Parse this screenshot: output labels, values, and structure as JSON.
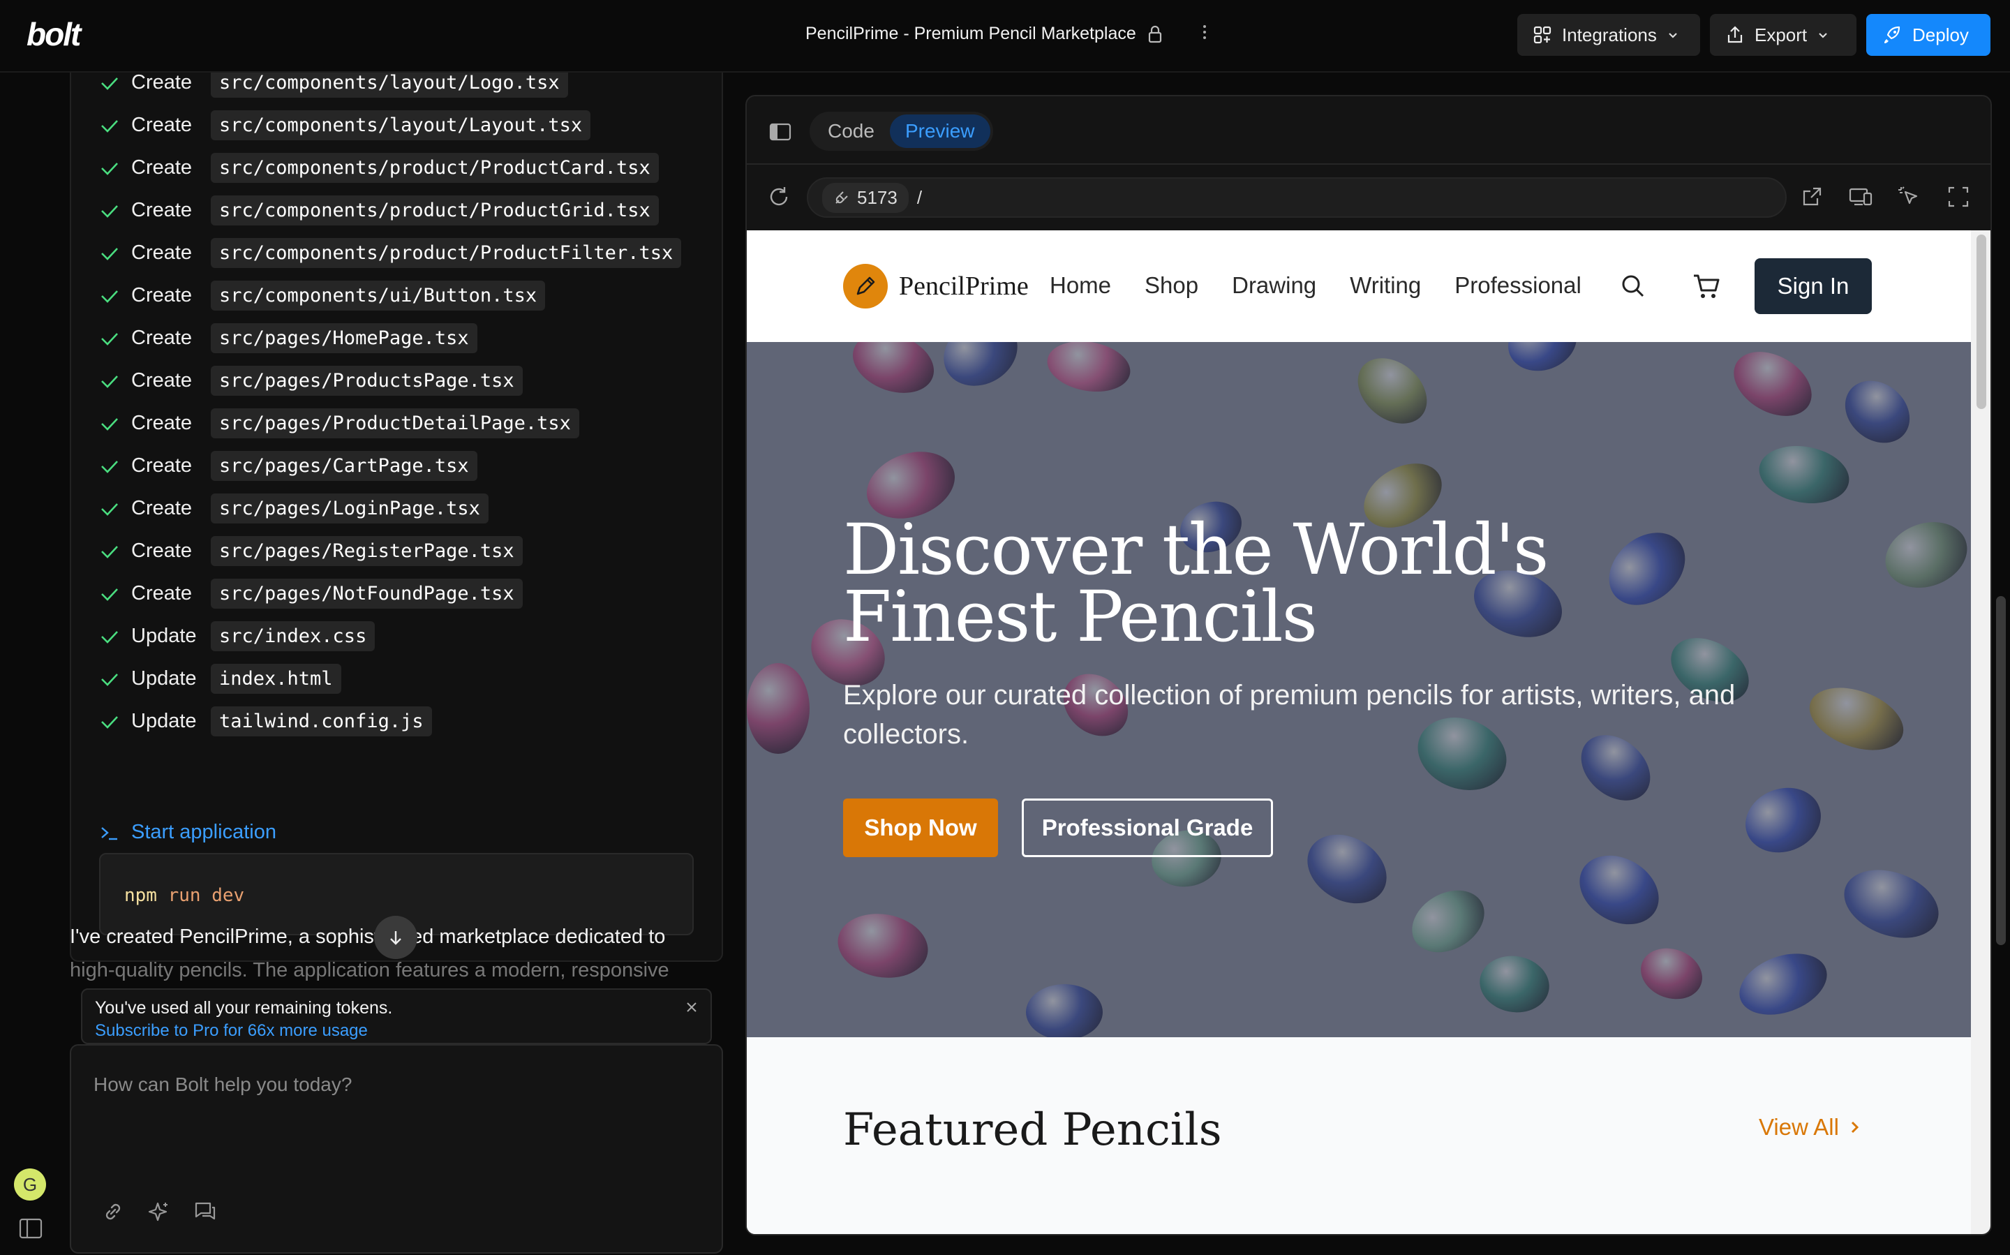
{
  "topbar": {
    "logo": "bolt",
    "project_title": "PencilPrime - Premium Pencil Marketplace",
    "integrations_label": "Integrations",
    "export_label": "Export",
    "deploy_label": "Deploy"
  },
  "actions": [
    {
      "verb": "Create",
      "path": "src/components/layout/Logo.tsx"
    },
    {
      "verb": "Create",
      "path": "src/components/layout/Layout.tsx"
    },
    {
      "verb": "Create",
      "path": "src/components/product/ProductCard.tsx"
    },
    {
      "verb": "Create",
      "path": "src/components/product/ProductGrid.tsx"
    },
    {
      "verb": "Create",
      "path": "src/components/product/ProductFilter.tsx"
    },
    {
      "verb": "Create",
      "path": "src/components/ui/Button.tsx"
    },
    {
      "verb": "Create",
      "path": "src/pages/HomePage.tsx"
    },
    {
      "verb": "Create",
      "path": "src/pages/ProductsPage.tsx"
    },
    {
      "verb": "Create",
      "path": "src/pages/ProductDetailPage.tsx"
    },
    {
      "verb": "Create",
      "path": "src/pages/CartPage.tsx"
    },
    {
      "verb": "Create",
      "path": "src/pages/LoginPage.tsx"
    },
    {
      "verb": "Create",
      "path": "src/pages/RegisterPage.tsx"
    },
    {
      "verb": "Create",
      "path": "src/pages/NotFoundPage.tsx"
    },
    {
      "verb": "Update",
      "path": "src/index.css"
    },
    {
      "verb": "Update",
      "path": "index.html"
    },
    {
      "verb": "Update",
      "path": "tailwind.config.js"
    }
  ],
  "start_application": "Start application",
  "terminal": {
    "cmd": "npm",
    "args": "run dev"
  },
  "summary": {
    "line1": "I've created PencilPrime, a sophisticated marketplace dedicated to",
    "line2": "high-quality pencils. The application features a modern, responsive"
  },
  "token_notice": {
    "title": "You've used all your remaining tokens.",
    "link": "Subscribe to Pro for 66x more usage"
  },
  "chat": {
    "placeholder": "How can Bolt help you today?"
  },
  "user": {
    "initial": "G"
  },
  "workbench": {
    "tabs": [
      {
        "label": "Code",
        "active": false
      },
      {
        "label": "Preview",
        "active": true
      }
    ],
    "port": "5173",
    "path": "/"
  },
  "site": {
    "name": "PencilPrime",
    "nav": [
      "Home",
      "Shop",
      "Drawing",
      "Writing",
      "Professional"
    ],
    "signin": "Sign In",
    "hero_title": "Discover the World's Finest Pencils",
    "hero_sub": "Explore our curated collection of premium pencils for artists, writers, and collectors.",
    "btn_shop": "Shop Now",
    "btn_pro": "Professional Grade",
    "featured_title": "Featured Pencils",
    "view_all": "View All"
  },
  "colors": {
    "accent_blue": "#1488fc",
    "site_orange": "#d97706",
    "signin_bg": "#1c2937"
  }
}
